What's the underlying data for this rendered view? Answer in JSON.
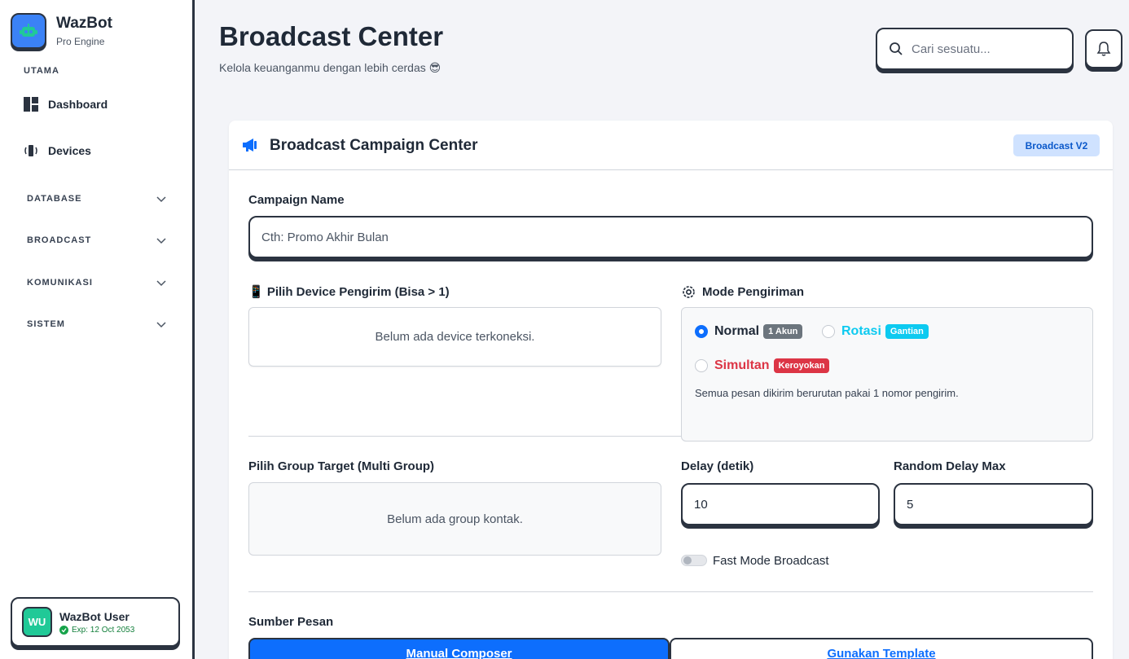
{
  "app": {
    "name": "WazBot",
    "subtitle": "Pro Engine"
  },
  "sidebar": {
    "section_main": "UTAMA",
    "items": [
      {
        "label": "Dashboard",
        "icon": "dashboard-icon"
      },
      {
        "label": "Devices",
        "icon": "devices-icon"
      }
    ],
    "groups": [
      {
        "label": "DATABASE"
      },
      {
        "label": "BROADCAST"
      },
      {
        "label": "KOMUNIKASI"
      },
      {
        "label": "SISTEM"
      }
    ],
    "user": {
      "initials": "WU",
      "name": "WazBot User",
      "exp": "Exp: 12 Oct 2053"
    }
  },
  "header": {
    "title": "Broadcast Center",
    "subtitle": "Kelola keuanganmu dengan lebih cerdas 😎",
    "search_placeholder": "Cari sesuatu..."
  },
  "card": {
    "title": "Broadcast Campaign Center",
    "badge": "Broadcast V2",
    "campaign_label": "Campaign Name",
    "campaign_placeholder": "Cth: Promo Akhir Bulan",
    "device_label": "📱 Pilih Device Pengirim (Bisa > 1)",
    "device_empty": "Belum ada device terkoneksi.",
    "mode_label": "Mode Pengiriman",
    "modes": [
      {
        "label": "Normal",
        "pill": "1 Akun",
        "selected": true,
        "color": "#1f2937",
        "pill_color": "#6c757d"
      },
      {
        "label": "Rotasi",
        "pill": "Gantian",
        "selected": false,
        "color": "#0dcaf0",
        "pill_color": "#0dcaf0"
      },
      {
        "label": "Simultan",
        "pill": "Keroyokan",
        "selected": false,
        "color": "#dc3545",
        "pill_color": "#dc3545"
      }
    ],
    "mode_desc": "Semua pesan dikirim berurutan pakai 1 nomor pengirim.",
    "group_label": "Pilih Group Target (Multi Group)",
    "group_empty": "Belum ada group kontak.",
    "delay_label": "Delay (detik)",
    "delay_value": "10",
    "random_label": "Random Delay Max",
    "random_value": "5",
    "fast_mode_label": "Fast Mode Broadcast",
    "fast_mode_on": false,
    "source_label": "Sumber Pesan",
    "source_tabs": [
      {
        "label": "Manual Composer",
        "active": true
      },
      {
        "label": "Gunakan Template",
        "active": false
      }
    ]
  },
  "colors": {
    "primary": "#0d6efd",
    "border_dark": "#2b3340",
    "success": "#20c997"
  }
}
